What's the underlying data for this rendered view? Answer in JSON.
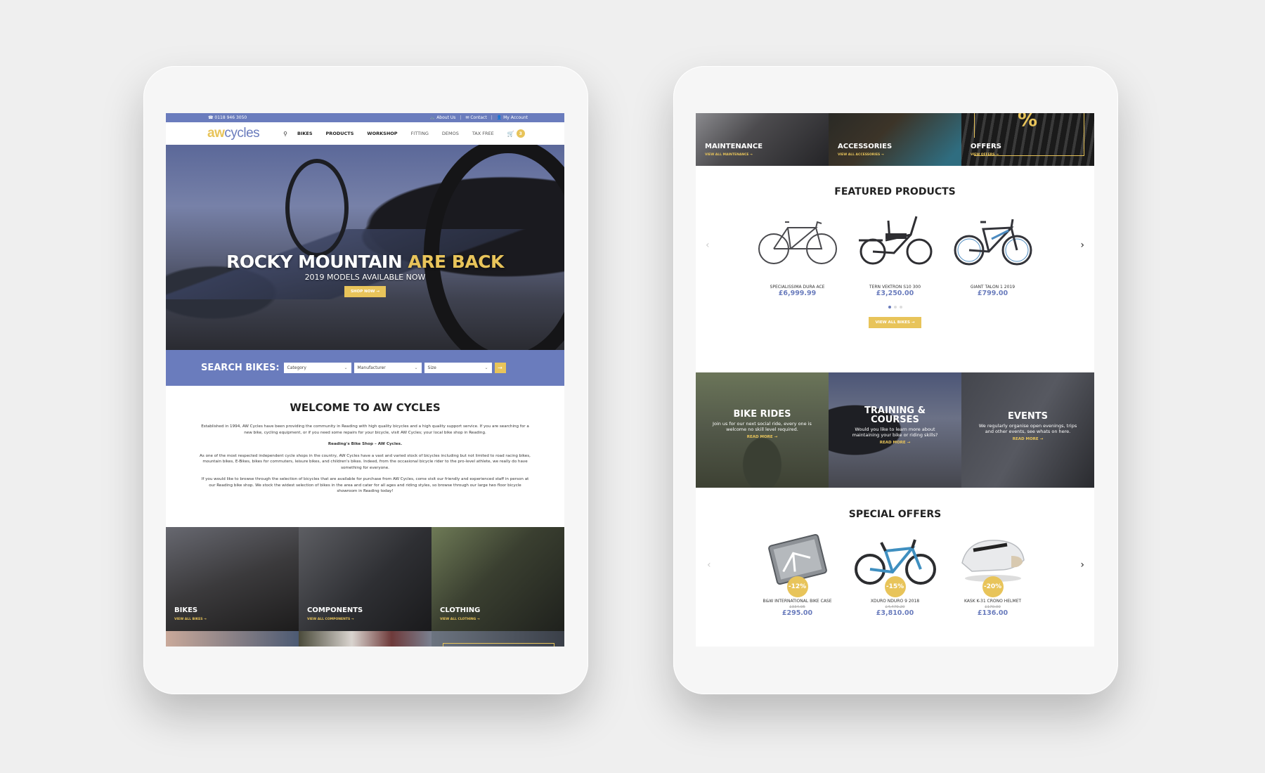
{
  "colors": {
    "brand_blue": "#6a7cbd",
    "brand_yellow": "#e8c45a",
    "background": "#efefef"
  },
  "left_screen": {
    "topbar": {
      "phone_icon": "phone-icon",
      "phone": "0118 946 3050",
      "links": [
        {
          "icon": "bicycle-icon",
          "label": "About Us"
        },
        {
          "icon": "envelope-icon",
          "label": "Contact"
        },
        {
          "icon": "user-icon",
          "label": "My Account"
        }
      ],
      "separator": "|"
    },
    "nav": {
      "logo_aw": "aw",
      "logo_cycles": "cycles",
      "search_icon": "search-icon",
      "items": [
        "BIKES",
        "PRODUCTS",
        "WORKSHOP",
        "FITTING",
        "DEMOS",
        "TAX FREE"
      ],
      "cart_icon": "cart-icon",
      "cart_count": "3"
    },
    "hero": {
      "title_white": "ROCKY MOUNTAIN",
      "title_yellow": "ARE BACK",
      "subtitle": "2019 MODELS AVAILABLE NOW",
      "button": "SHOP NOW",
      "button_arrow": "→"
    },
    "search": {
      "label": "SEARCH BIKES:",
      "selects": [
        "Category",
        "Manufacturer",
        "Size"
      ],
      "chevron": "⌄",
      "go": "→"
    },
    "welcome": {
      "title": "WELCOME TO AW CYCLES",
      "p1": "Established in 1994, AW Cycles have been providing the community in Reading with high quality bicycles and a high quality support service. If you are searching for a new bike, cycling equipment, or if you need some repairs for your bicycle, visit AW Cycles; your local bike shop in Reading.",
      "p2": "Reading's Bike Shop – AW Cycles.",
      "p3": "As one of the most respected independent cycle shops in the country, AW Cycles have a vast and varied stock of bicycles including but not limited to road racing bikes, mountain bikes, E-Bikes, bikes for commuters, leisure bikes, and children's bikes. Indeed, from the occasional bicycle rider to the pro-level athlete, we really do have something for everyone.",
      "p4": "If you would like to browse through the selection of bicycles that are available for purchase from AW Cycles, come visit our friendly and experienced staff in person at our Reading bike shop. We stock the widest selection of bikes in the area and cater for all ages and riding styles, so browse through our large two floor bicycle showroom in Reading today!"
    },
    "categories": [
      {
        "title": "BIKES",
        "link": "VIEW ALL BIKES →"
      },
      {
        "title": "COMPONENTS",
        "link": "VIEW ALL COMPONENTS →"
      },
      {
        "title": "CLOTHING",
        "link": "VIEW ALL CLOTHING →"
      }
    ]
  },
  "right_screen": {
    "tiles": [
      {
        "title": "MAINTENANCE",
        "link": "VIEW ALL MAINTENANCE →"
      },
      {
        "title": "ACCESSORIES",
        "link": "VIEW ALL ACCESSORIES →"
      },
      {
        "title": "OFFERS",
        "link": "VIEW OFFERS →",
        "symbol": "%"
      }
    ],
    "featured": {
      "title": "FEATURED PRODUCTS",
      "prev": "‹",
      "next": "›",
      "products": [
        {
          "name": "SPECIALISSIMA DURA ACE",
          "price": "£6,999.99"
        },
        {
          "name": "TERN VEKTRON S10 300",
          "price": "£3,250.00"
        },
        {
          "name": "GIANT TALON 1 2019",
          "price": "£799.00"
        }
      ],
      "active_page": 1,
      "page_count": 3,
      "button": "VIEW ALL BIKES →"
    },
    "events": [
      {
        "title": "BIKE RIDES",
        "desc": "Join us for our next social ride, every one is welcome no skill level required.",
        "link": "READ MORE →"
      },
      {
        "title": "TRAINING & COURSES",
        "desc": "Would you like to learn more about maintaining your bike or riding skills?",
        "link": "READ MORE →"
      },
      {
        "title": "EVENTS",
        "desc": "We regularly organise open evenings, trips and other events, see whats on here.",
        "link": "READ MORE →"
      }
    ],
    "offers": {
      "title": "SPECIAL OFFERS",
      "prev": "‹",
      "next": "›",
      "products": [
        {
          "name": "B&W INTERNATIONAL BIKE CASE",
          "old_price": "£334.95",
          "price": "£295.00",
          "discount": "-12%"
        },
        {
          "name": "XDURO NDURO 9 2018",
          "old_price": "£4,479.20",
          "price": "£3,810.00",
          "discount": "-15%"
        },
        {
          "name": "KASK K-31 CRONO HELMET",
          "old_price": "£170.00",
          "price": "£136.00",
          "discount": "-20%"
        }
      ]
    }
  }
}
